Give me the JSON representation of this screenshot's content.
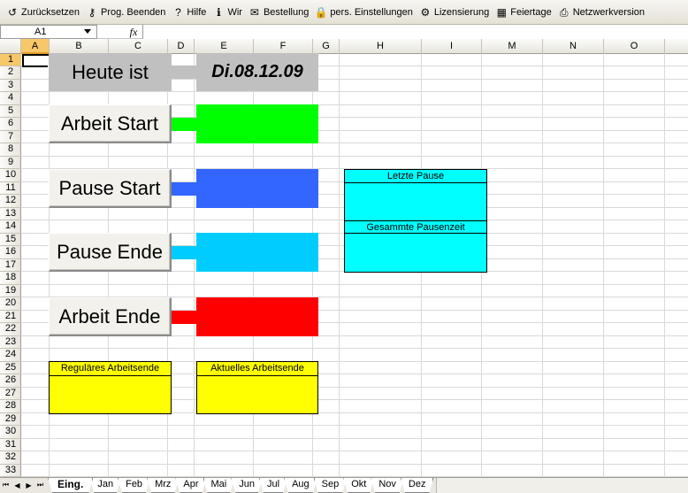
{
  "toolbar": {
    "items": [
      {
        "label": "Zurücksetzen",
        "icon": "reset-icon",
        "glyph": "↺"
      },
      {
        "label": "Prog. Beenden",
        "icon": "key-icon",
        "glyph": "⚷"
      },
      {
        "label": "Hilfe",
        "icon": "help-icon",
        "glyph": "?"
      },
      {
        "label": "Wir",
        "icon": "info-icon",
        "glyph": "ℹ"
      },
      {
        "label": "Bestellung",
        "icon": "order-icon",
        "glyph": "✉"
      },
      {
        "label": "pers. Einstellungen",
        "icon": "lock-icon",
        "glyph": "🔒"
      },
      {
        "label": "Lizensierung",
        "icon": "license-icon",
        "glyph": "⚙"
      },
      {
        "label": "Feiertage",
        "icon": "calendar-icon",
        "glyph": "▦"
      },
      {
        "label": "Netzwerkversion",
        "icon": "printer-icon",
        "glyph": "⎙"
      }
    ]
  },
  "formula_bar": {
    "cell_ref": "A1",
    "fx_label": "fx",
    "content": ""
  },
  "columns": [
    "A",
    "B",
    "C",
    "D",
    "E",
    "F",
    "G",
    "H",
    "I",
    "M",
    "N",
    "O"
  ],
  "selected_column": "A",
  "rows": [
    "1",
    "2",
    "3",
    "4",
    "5",
    "6",
    "7",
    "8",
    "9",
    "10",
    "11",
    "12",
    "13",
    "14",
    "15",
    "16",
    "17",
    "18",
    "19",
    "20",
    "21",
    "22",
    "23",
    "24",
    "25",
    "26",
    "27",
    "28",
    "29",
    "30",
    "31",
    "32",
    "33"
  ],
  "selected_row": "1",
  "sheet": {
    "today_label": "Heute ist",
    "date_value": "Di.08.12.09",
    "buttons": [
      {
        "label": "Arbeit Start",
        "color": "#00ff00"
      },
      {
        "label": "Pause Start",
        "color": "#3366ff"
      },
      {
        "label": "Pause Ende",
        "color": "#00ccff"
      },
      {
        "label": "Arbeit Ende",
        "color": "#ff0000"
      }
    ],
    "pause_panel": {
      "last_pause_label": "Letzte Pause",
      "total_pause_label": "Gesammte Pausenzeit",
      "color": "#00ffff"
    },
    "regular_end_label": "Reguläres Arbeitsende",
    "current_end_label": "Aktuelles Arbeitsende",
    "yellow": "#ffff00"
  },
  "tabs": [
    "Eing.",
    "Jan",
    "Feb",
    "Mrz",
    "Apr",
    "Mai",
    "Jun",
    "Jul",
    "Aug",
    "Sep",
    "Okt",
    "Nov",
    "Dez"
  ],
  "active_tab": "Eing."
}
